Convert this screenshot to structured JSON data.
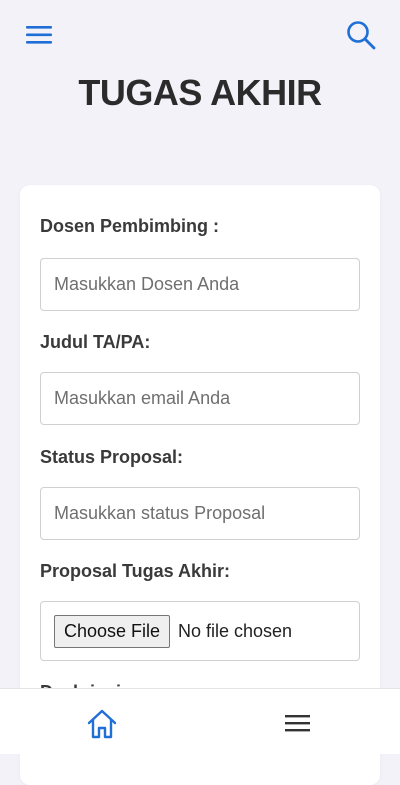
{
  "header": {
    "title": "TUGAS AKHIR",
    "menu_icon": "hamburger-icon",
    "search_icon": "search-icon",
    "accent_color": "#1f6fd6"
  },
  "form": {
    "fields": [
      {
        "label": "Dosen Pembimbing :",
        "placeholder": "Masukkan Dosen Anda",
        "value": ""
      },
      {
        "label": "Judul TA/PA:",
        "placeholder": "Masukkan email Anda",
        "value": ""
      },
      {
        "label": "Status Proposal:",
        "placeholder": "Masukkan status Proposal",
        "value": ""
      }
    ],
    "file_field": {
      "label": "Proposal Tugas Akhir:",
      "button_label": "Choose File",
      "status": "No file chosen"
    },
    "next_label_partial": "Deskripsi"
  },
  "bottom_nav": {
    "home_icon": "home-icon",
    "menu_icon": "hamburger-icon"
  }
}
